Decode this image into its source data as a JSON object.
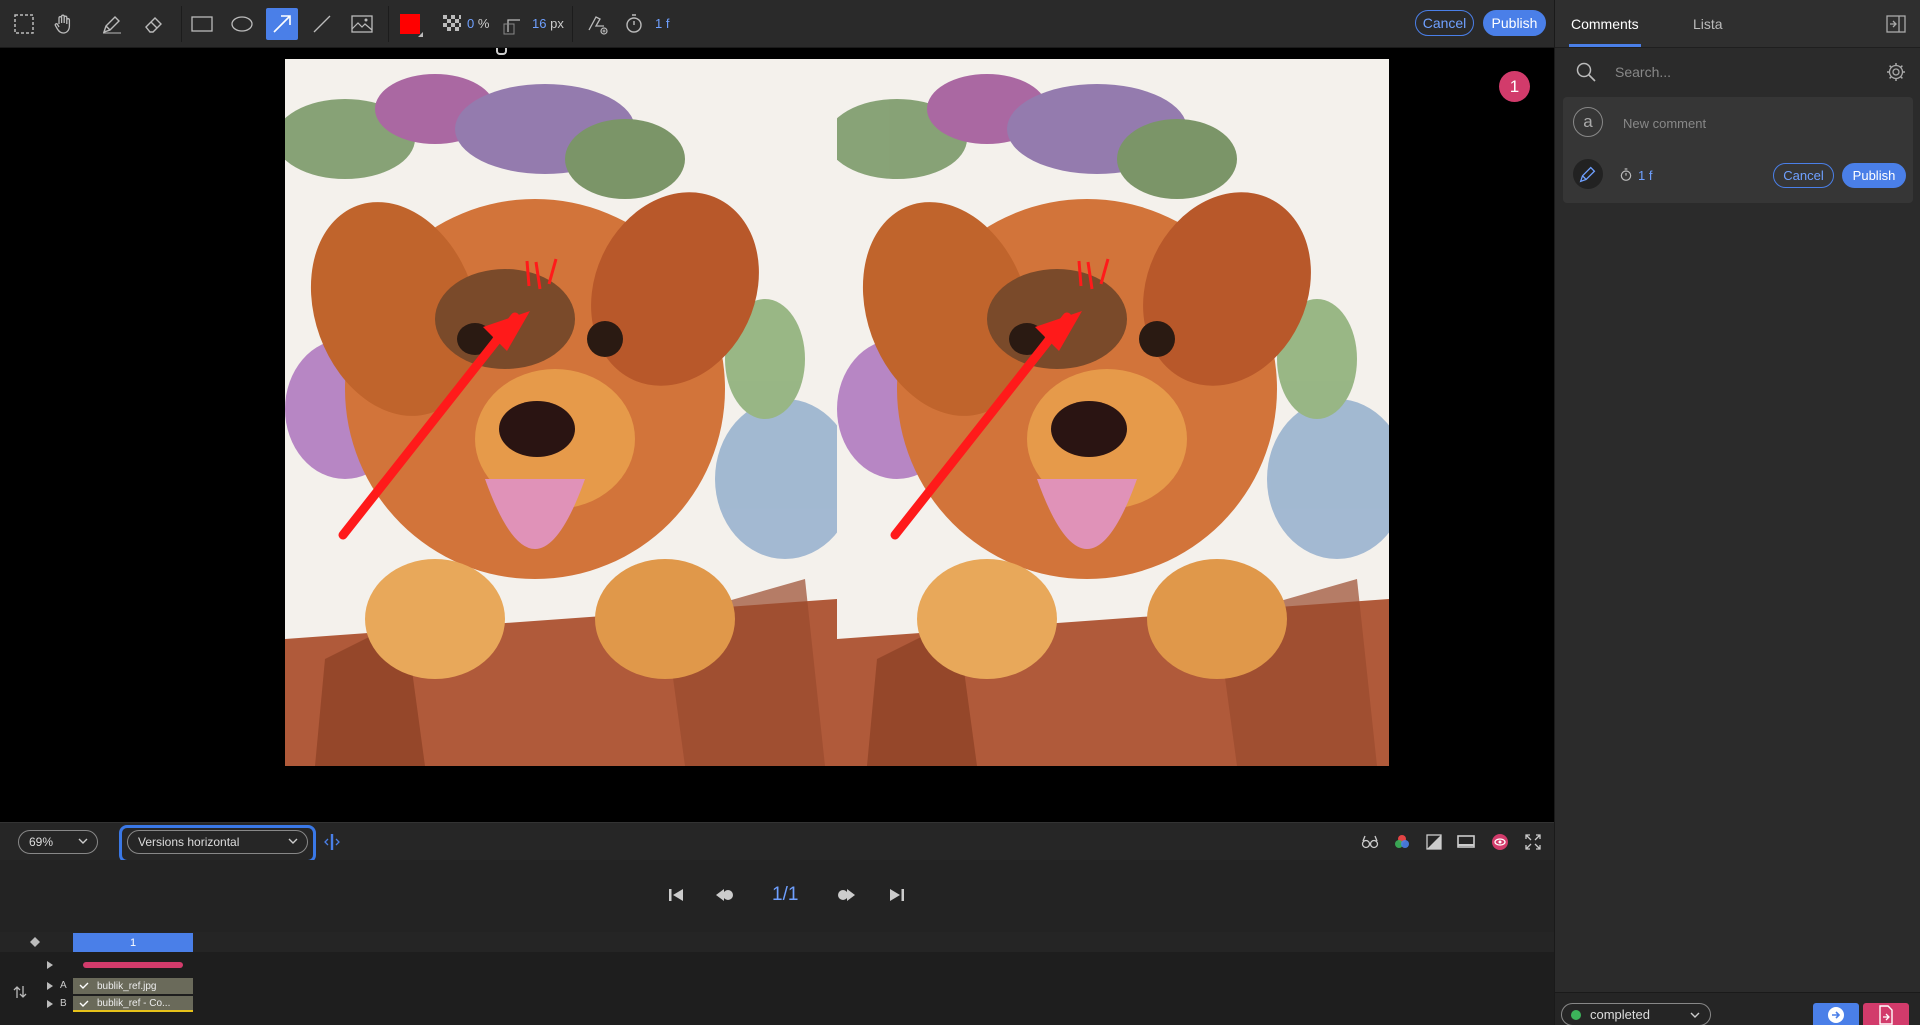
{
  "toolbar": {
    "tools": [
      {
        "name": "marquee-select-icon"
      },
      {
        "name": "hand-pan-icon"
      },
      {
        "name": "pen-brush-icon"
      },
      {
        "name": "eraser-icon"
      },
      {
        "name": "rectangle-icon"
      },
      {
        "name": "ellipse-icon"
      },
      {
        "name": "arrow-icon",
        "active": true
      },
      {
        "name": "line-icon"
      },
      {
        "name": "image-icon"
      }
    ],
    "color": "#ff0000",
    "opacity_value": "0",
    "opacity_unit": "%",
    "size_value": "16",
    "size_unit": "px",
    "duration_value": "1",
    "duration_unit": "f",
    "cancel_label": "Cancel",
    "publish_label": "Publish"
  },
  "viewer": {
    "marker_count": "1",
    "annotation_color": "#ff1a1a"
  },
  "controlbar": {
    "zoom": "69%",
    "layout": "Versions horizontal",
    "accent": "#4a7fe8",
    "right_icons": [
      "compare-icon",
      "color-channels-icon",
      "exposure-icon",
      "display-icon",
      "visibility-eye-icon",
      "fullscreen-icon"
    ]
  },
  "playback": {
    "frame_counter": "1/1"
  },
  "timeline": {
    "frame_label": "1",
    "track_a_label": "A",
    "track_b_label": "B",
    "track_a_name": "bublik_ref.jpg",
    "track_b_name": "bublik_ref - Co..."
  },
  "panel": {
    "tabs": [
      {
        "label": "Comments",
        "active": true
      },
      {
        "label": "Lista",
        "active": false
      }
    ],
    "search_placeholder": "Search...",
    "avatar_letter": "a",
    "new_comment_placeholder": "New comment",
    "comment_duration_value": "1",
    "comment_duration_unit": "f",
    "cancel_label": "Cancel",
    "publish_label": "Publish",
    "status": "completed",
    "status_color": "#3cb35a"
  }
}
